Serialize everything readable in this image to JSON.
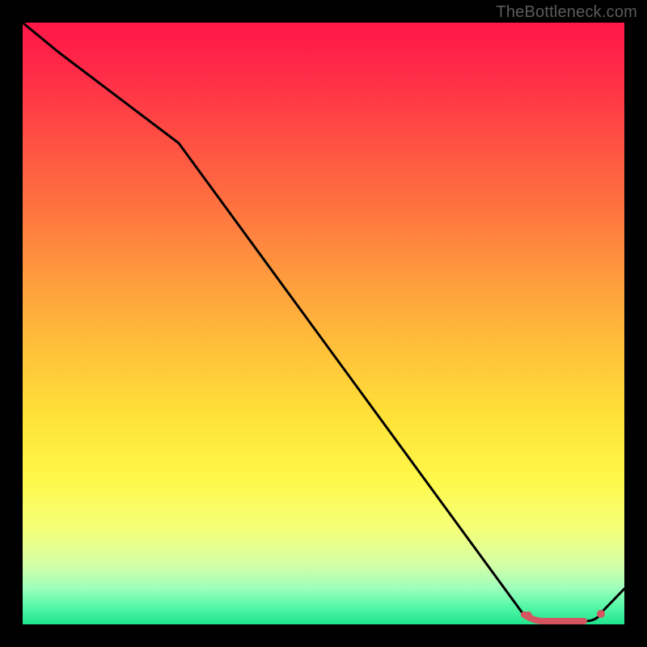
{
  "watermark": "TheBottleneck.com",
  "chart_data": {
    "type": "line",
    "title": "",
    "xlabel": "",
    "ylabel": "",
    "xlim": [
      0,
      100
    ],
    "ylim": [
      0,
      100
    ],
    "x": [
      0,
      6,
      26,
      83,
      86,
      93,
      96,
      100
    ],
    "values": [
      100,
      95,
      80,
      2,
      1,
      1,
      2,
      6
    ],
    "series": [
      {
        "name": "curve",
        "x": [
          0,
          6,
          26,
          83,
          86,
          93,
          96,
          100
        ],
        "values": [
          100,
          95,
          80,
          2,
          1,
          1,
          2,
          6
        ]
      }
    ],
    "markers": [
      {
        "x": 84,
        "y": 2
      },
      {
        "x": 96,
        "y": 2
      }
    ],
    "colors": {
      "line": "#000000",
      "marker": "#d55560",
      "gradient_top": "#ff1747",
      "gradient_bottom": "#1fe58e"
    }
  }
}
